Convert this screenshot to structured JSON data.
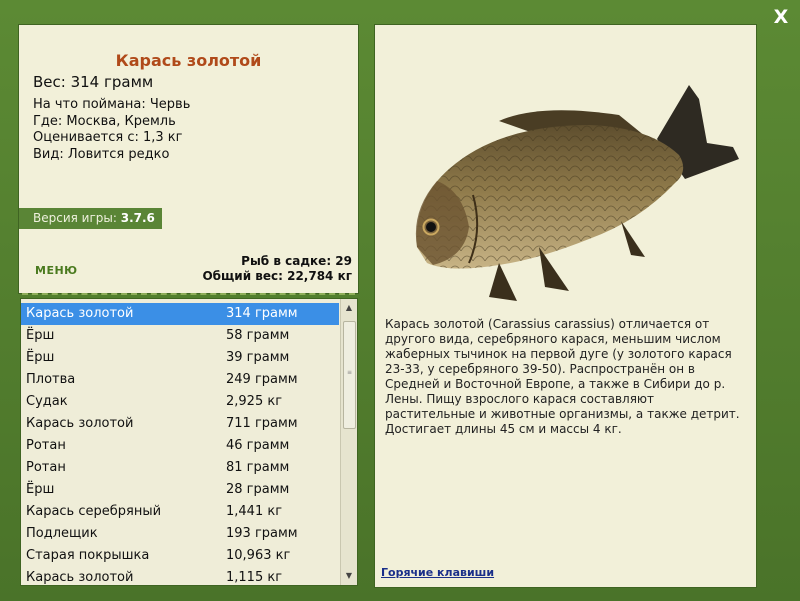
{
  "close_label": "X",
  "fish": {
    "name": "Карась золотой",
    "weight_line": "Вес: 314 грамм",
    "details": [
      "На что поймана: Червь",
      "Где: Москва, Кремль",
      "Оценивается с: 1,3 кг",
      "Вид: Ловится редко"
    ]
  },
  "version": {
    "label": "Версия игры:",
    "value": "3.7.6"
  },
  "menu_label": "МЕНЮ",
  "stats": {
    "fish_count": "Рыб в садке: 29",
    "total_weight": "Общий вес: 22,784 кг"
  },
  "catch_list": [
    {
      "name": "Карась золотой",
      "weight": "314 грамм",
      "selected": true
    },
    {
      "name": "Ёрш",
      "weight": "58 грамм"
    },
    {
      "name": "Ёрш",
      "weight": "39 грамм"
    },
    {
      "name": "Плотва",
      "weight": "249 грамм"
    },
    {
      "name": "Судак",
      "weight": "2,925 кг"
    },
    {
      "name": "Карась золотой",
      "weight": "711 грамм"
    },
    {
      "name": "Ротан",
      "weight": "46 грамм"
    },
    {
      "name": "Ротан",
      "weight": "81 грамм"
    },
    {
      "name": "Ёрш",
      "weight": "28 грамм"
    },
    {
      "name": "Карась серебряный",
      "weight": "1,441 кг"
    },
    {
      "name": "Подлещик",
      "weight": "193 грамм"
    },
    {
      "name": "Старая покрышка",
      "weight": "10,963 кг"
    },
    {
      "name": "Карась золотой",
      "weight": "1,115 кг"
    }
  ],
  "description": "Карась золотой (Carassius carassius) отличается от другого вида, серебряного карася, меньшим числом жаберных тычинок на первой дуге (у золотого карася 23-33, у серебряного 39-50). Распространён он в Средней и Восточной Европе, а также в Сибири до р. Лены. Пищу взрослого карася составляют растительные и животные организмы, а также детрит. Достигает длины 45 см и массы 4 кг.",
  "hotkeys_label": "Горячие клавиши",
  "icons": {
    "close": "close-icon",
    "scroll_up": "arrow-up-icon",
    "scroll_down": "arrow-down-icon",
    "fish": "carp-fish-image"
  },
  "colors": {
    "frame": "#4f7a2c",
    "panel": "#f2f0d9",
    "title": "#b04a1a",
    "selection": "#3b8fe6",
    "link": "#1a2f8a"
  }
}
